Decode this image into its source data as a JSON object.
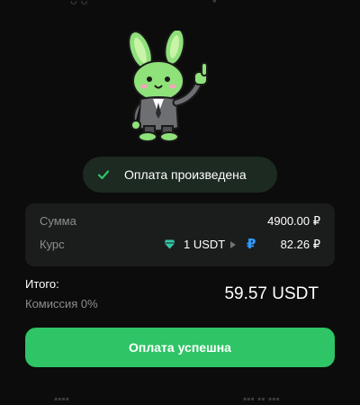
{
  "status": {
    "text": "Оплата произведена"
  },
  "details": {
    "sum": {
      "label": "Сумма",
      "value": "4900.00 ₽"
    },
    "rate": {
      "label": "Курс",
      "from": "1 USDT",
      "currency_symbol": "₽",
      "value": "82.26 ₽"
    }
  },
  "summary": {
    "total_label": "Итого:",
    "commission": "Комиссия 0%",
    "total_amount": "59.57 USDT"
  },
  "button": {
    "label": "Оплата успешна"
  },
  "colors": {
    "accent": "#2fc465",
    "status_bg": "#1d2a22",
    "card_bg": "#1b1d1c",
    "ruble_icon": "#2f9bff",
    "gem_icon": "#34c3a4"
  },
  "icons": [
    "bunny-mascot",
    "check-icon",
    "gem-icon",
    "play-arrow-icon",
    "ruble-icon"
  ]
}
